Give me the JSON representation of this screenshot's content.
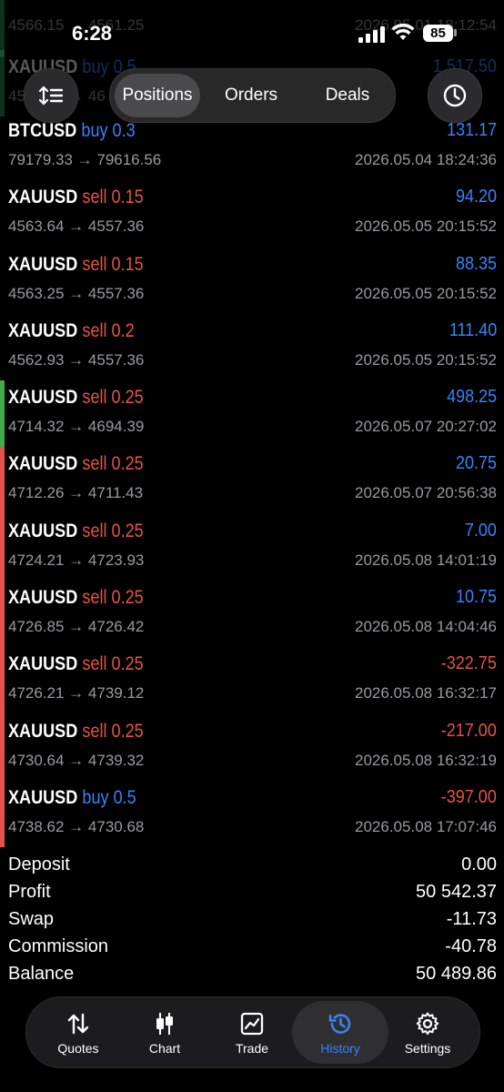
{
  "status": {
    "time": "6:28",
    "battery": "85"
  },
  "ghost_rows": [
    {
      "text_left": "4566.15 → 4561.25",
      "text_right": "2026.05.01 18:12:54",
      "bar": "#2e8b57"
    },
    {
      "symbol": "XAUUSD",
      "dir": "buy 0.5",
      "text_left": "4566.15 → 46",
      "profit": "1 517.50",
      "bar": "#2e8b57"
    }
  ],
  "nav": {
    "tabs": [
      "Positions",
      "Orders",
      "Deals"
    ],
    "active": "Positions"
  },
  "trades": [
    {
      "symbol": "BTCUSD",
      "side": "buy",
      "volume": "0.3",
      "open": "79179.33",
      "close": "79616.56",
      "time": "2026.05.04 18:24:36",
      "profit": "131.17",
      "bar": "#000000"
    },
    {
      "symbol": "XAUUSD",
      "side": "sell",
      "volume": "0.15",
      "open": "4563.64",
      "close": "4557.36",
      "time": "2026.05.05 20:15:52",
      "profit": "94.20",
      "bar": "#000000"
    },
    {
      "symbol": "XAUUSD",
      "side": "sell",
      "volume": "0.15",
      "open": "4563.25",
      "close": "4557.36",
      "time": "2026.05.05 20:15:52",
      "profit": "88.35",
      "bar": "#000000"
    },
    {
      "symbol": "XAUUSD",
      "side": "sell",
      "volume": "0.2",
      "open": "4562.93",
      "close": "4557.36",
      "time": "2026.05.05 20:15:52",
      "profit": "111.40",
      "bar": "#000000"
    },
    {
      "symbol": "XAUUSD",
      "side": "sell",
      "volume": "0.25",
      "open": "4714.32",
      "close": "4694.39",
      "time": "2026.05.07 20:27:02",
      "profit": "498.25",
      "bar": "#3fae49"
    },
    {
      "symbol": "XAUUSD",
      "side": "sell",
      "volume": "0.25",
      "open": "4712.26",
      "close": "4711.43",
      "time": "2026.05.07 20:56:38",
      "profit": "20.75",
      "bar": "#e5534b"
    },
    {
      "symbol": "XAUUSD",
      "side": "sell",
      "volume": "0.25",
      "open": "4724.21",
      "close": "4723.93",
      "time": "2026.05.08 14:01:19",
      "profit": "7.00",
      "bar": "#e5534b"
    },
    {
      "symbol": "XAUUSD",
      "side": "sell",
      "volume": "0.25",
      "open": "4726.85",
      "close": "4726.42",
      "time": "2026.05.08 14:04:46",
      "profit": "10.75",
      "bar": "#e5534b"
    },
    {
      "symbol": "XAUUSD",
      "side": "sell",
      "volume": "0.25",
      "open": "4726.21",
      "close": "4739.12",
      "time": "2026.05.08 16:32:17",
      "profit": "-322.75",
      "bar": "#e5534b"
    },
    {
      "symbol": "XAUUSD",
      "side": "sell",
      "volume": "0.25",
      "open": "4730.64",
      "close": "4739.32",
      "time": "2026.05.08 16:32:19",
      "profit": "-217.00",
      "bar": "#e5534b"
    },
    {
      "symbol": "XAUUSD",
      "side": "buy",
      "volume": "0.5",
      "open": "4738.62",
      "close": "4730.68",
      "time": "2026.05.08 17:07:46",
      "profit": "-397.00",
      "bar": "#e5534b"
    }
  ],
  "summary": [
    {
      "label": "Deposit",
      "value": "0.00"
    },
    {
      "label": "Profit",
      "value": "50 542.37"
    },
    {
      "label": "Swap",
      "value": "-11.73"
    },
    {
      "label": "Commission",
      "value": "-40.78"
    },
    {
      "label": "Balance",
      "value": "50 489.86"
    }
  ],
  "tabbar": {
    "items": [
      {
        "label": "Quotes",
        "icon": "quotes-arrows-icon"
      },
      {
        "label": "Chart",
        "icon": "candlestick-icon"
      },
      {
        "label": "Trade",
        "icon": "trade-chart-icon"
      },
      {
        "label": "History",
        "icon": "history-clock-icon"
      },
      {
        "label": "Settings",
        "icon": "gear-icon"
      }
    ],
    "active": "History"
  },
  "colors": {
    "buy": "#3b82f6",
    "sell": "#e5534b",
    "profit_pos": "#3b82f6",
    "profit_neg": "#e5534b",
    "muted": "#9a9a9e"
  }
}
